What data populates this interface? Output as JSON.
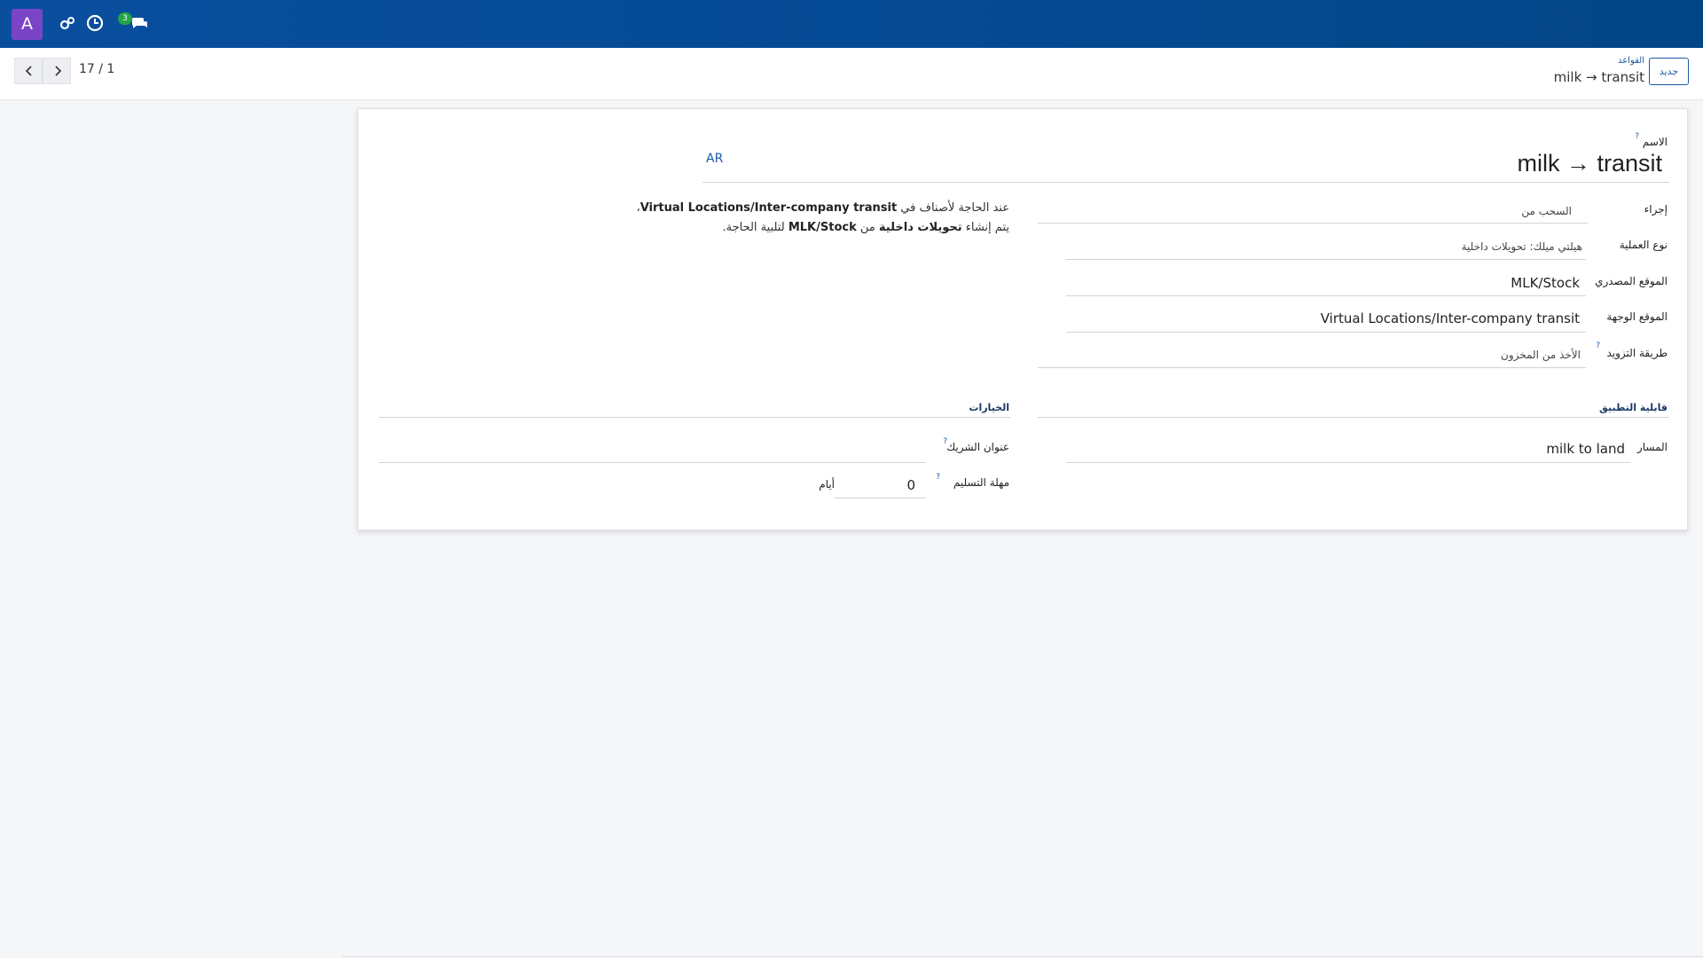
{
  "navbar": {
    "avatar_letter": "A",
    "badge_count": "3",
    "icons": [
      "gears-icon",
      "clock-icon",
      "chat-icon"
    ],
    "background": "#0a4f9e"
  },
  "control": {
    "pager": "17 / 1",
    "new_button": "جديد",
    "breadcrumb_parent": "القواعد",
    "breadcrumb_current": "milk → transit"
  },
  "form": {
    "name_label": "الاسم",
    "name_value": "milk → transit",
    "lang": "AR",
    "action_label": "إجراء",
    "action_value": "السحب من",
    "operation_type_label": "نوع العملية",
    "operation_type_value": "هيلتي ميلك: تحويلات داخلية",
    "source_location_label": "الموقع المصدري",
    "source_location_value": "MLK/Stock",
    "dest_location_label": "الموقع الوجهة",
    "dest_location_value": "Virtual Locations/Inter-company transit",
    "supply_method_label": "طريقة التزويد",
    "supply_method_value": "الأخذ من المخزون",
    "applicability_title": "قابلية التطبيق",
    "options_title": "الخيارات",
    "route_label": "المسار",
    "route_value": "milk to land",
    "partner_address_label": "عنوان الشريك",
    "partner_address_value": "",
    "lead_time_label": "مهلة التسليم",
    "lead_time_value": "0",
    "lead_time_unit": "أيام",
    "help_mark": "?"
  },
  "description": {
    "line1_prefix": "عند الحاجة لأصناف في",
    "line1_location": "Virtual Locations/Inter-company transit",
    "line1_suffix": "،",
    "line2_prefix": "يتم إنشاء",
    "line2_bold": "تحويلات داخلية",
    "line2_mid": "من",
    "line2_location": "MLK/Stock",
    "line2_suffix": "لتلبية الحاجة."
  }
}
